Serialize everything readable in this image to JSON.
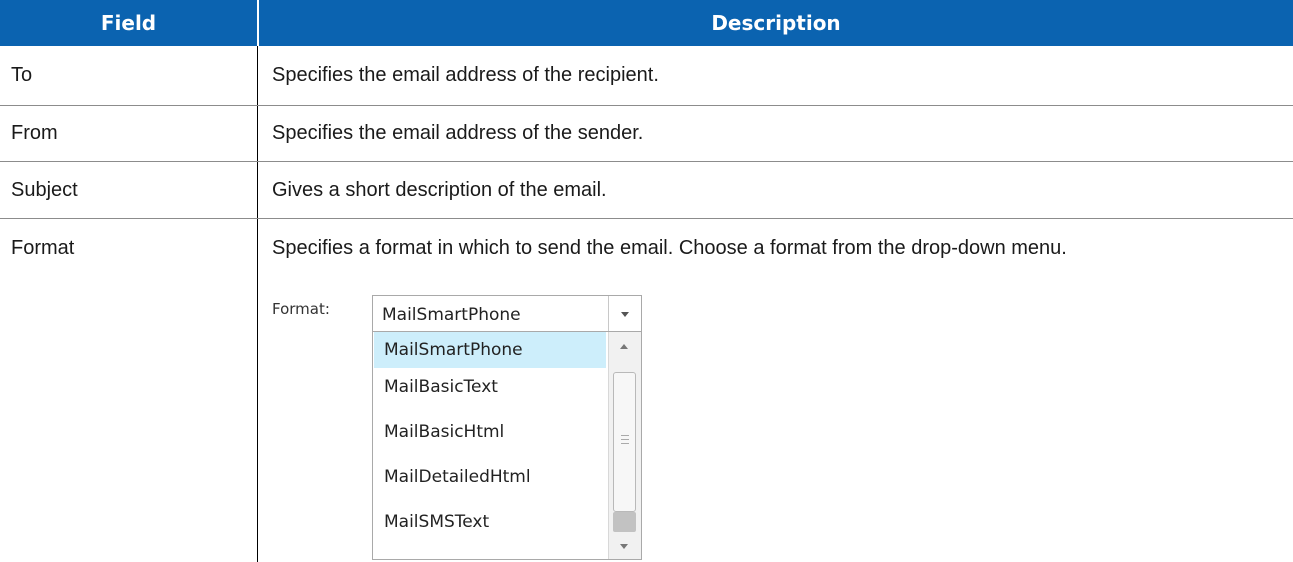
{
  "table": {
    "headers": [
      "Field",
      "Description"
    ],
    "rows": [
      {
        "field": "To",
        "description": "Specifies the email address of the recipient."
      },
      {
        "field": "From",
        "description": "Specifies the email address of the sender."
      },
      {
        "field": "Subject",
        "description": "Gives a short description of the email."
      },
      {
        "field": "Format",
        "description": "Specifies a format in which to send the email. Choose a format from the drop-down menu."
      }
    ]
  },
  "format_widget": {
    "label": "Format:",
    "selected": "MailSmartPhone",
    "options": [
      "MailSmartPhone",
      "MailBasicText",
      "MailBasicHtml",
      "MailDetailedHtml",
      "MailSMSText"
    ],
    "highlighted_index": 0
  },
  "colors": {
    "header_bg": "#0b63b0",
    "header_text": "#ffffff",
    "option_highlight": "#cdeefb"
  }
}
